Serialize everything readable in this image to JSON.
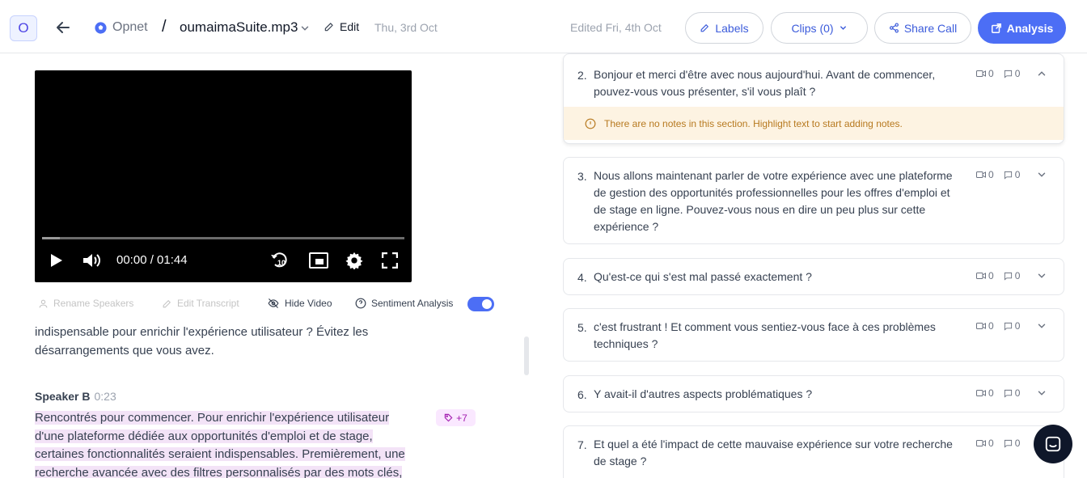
{
  "header": {
    "avatar_letter": "O",
    "workspace": "Opnet",
    "separator": "/",
    "file_name": "oumaimaSuite.mp3",
    "edit_label": "Edit",
    "date": "Thu, 3rd Oct",
    "edited": "Edited Fri, 4th Oct",
    "buttons": {
      "labels": "Labels",
      "clips": "Clips (0)",
      "share": "Share Call",
      "analysis": "Analysis"
    }
  },
  "player": {
    "current_time": "00:00",
    "duration": "01:44",
    "progress": 0.05,
    "time_display": "00:00 / 01:44"
  },
  "toolbar": {
    "rename_speakers": "Rename Speakers",
    "edit_transcript": "Edit Transcript",
    "hide_video": "Hide Video",
    "sentiment_analysis": "Sentiment Analysis",
    "sentiment_enabled": true
  },
  "transcript": {
    "top_text": "indispensable pour enrichir l'expérience utilisateur ? Évitez les désarrangements que vous avez.",
    "speaker_name": "Speaker B",
    "speaker_time": "0:23",
    "tag_count": "+7",
    "highlight_text": "Rencontrés pour commencer. Pour enrichir l'expérience utilisateur d'une plateforme dédiée aux opportunités d'emploi et de stage, certaines fonctionnalités seraient indispensables. Premièrement, une recherche avancée avec des filtres personnalisés par des mots clés,"
  },
  "notes_banner": "There are no notes in this section. Highlight text to start adding notes.",
  "questions": [
    {
      "num": "2.",
      "text": "Bonjour et merci d'être avec nous aujourd'hui. Avant de commencer, pouvez-vous vous présenter, s'il vous plaît ?",
      "clips": "0",
      "notes": "0"
    },
    {
      "num": "3.",
      "text": "Nous allons maintenant parler de votre expérience avec une plateforme de gestion des opportunités professionnelles pour les offres d'emploi et de stage en ligne. Pouvez-vous nous en dire un peu plus sur cette expérience ?",
      "clips": "0",
      "notes": "0"
    },
    {
      "num": "4.",
      "text": "Qu'est-ce qui s'est mal passé exactement ?",
      "clips": "0",
      "notes": "0"
    },
    {
      "num": "5.",
      "text": "c'est frustrant ! Et comment vous sentiez-vous face à ces problèmes techniques ?",
      "clips": "0",
      "notes": "0"
    },
    {
      "num": "6.",
      "text": "Y avait-il d'autres aspects problématiques ?",
      "clips": "0",
      "notes": "0"
    },
    {
      "num": "7.",
      "text": "Et quel a été l'impact de cette mauvaise expérience sur votre recherche de stage ?",
      "clips": "0",
      "notes": "0"
    }
  ],
  "colors": {
    "accent": "#4c6ef5",
    "link": "#3b5bdb",
    "highlight": "#f3e3f7",
    "banner": "#fdf3e2",
    "banner_text": "#b7791f"
  }
}
